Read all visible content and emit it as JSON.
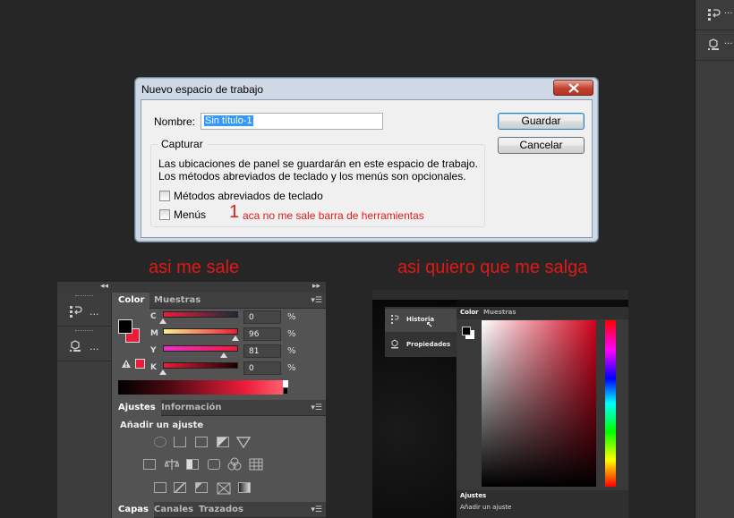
{
  "dialog": {
    "title": "Nuevo espacio de trabajo",
    "name_label": "Nombre:",
    "name_value": "Sin título-1",
    "save_label": "Guardar",
    "cancel_label": "Cancelar",
    "group_label": "Capturar",
    "description_line1": "Las ubicaciones de panel se guardarán en este espacio de trabajo.",
    "description_line2": "Los métodos abreviados de teclado y los menús son opcionales.",
    "checkbox_shortcuts": "Métodos abreviados de teclado",
    "checkbox_menus": "Menús",
    "annotation_number": "1",
    "annotation_text": "aca no me sale barra de herramientas"
  },
  "captions": {
    "left": "asi me sale",
    "right": "asi quiero que me salga"
  },
  "right_dock": {
    "items": [
      {
        "icon": "history-icon",
        "dots": "..."
      },
      {
        "icon": "properties-icon",
        "dots": "..."
      }
    ]
  },
  "left_screenshot": {
    "dock_items": [
      {
        "icon": "history-icon",
        "dots": "..."
      },
      {
        "icon": "properties-icon",
        "dots": "..."
      }
    ],
    "collapse_left": "◂◂",
    "collapse_right": "▸▸",
    "color_tabs": [
      "Color",
      "Muestras"
    ],
    "sliders": [
      {
        "label": "C",
        "value": "0",
        "unit": "%",
        "level": 0.0
      },
      {
        "label": "M",
        "value": "96",
        "unit": "%",
        "level": 0.96
      },
      {
        "label": "Y",
        "value": "81",
        "unit": "%",
        "level": 0.81
      },
      {
        "label": "K",
        "value": "0",
        "unit": "%",
        "level": 0.0
      }
    ],
    "adjust_tabs": [
      "Ajustes",
      "Información"
    ],
    "adjust_heading": "Añadir un ajuste",
    "bottom_tabs": [
      "Capas",
      "Canales",
      "Trazados"
    ],
    "colors": {
      "foreground": "#000000",
      "background": "#ed1c3a",
      "accent": "#e21a1a"
    }
  },
  "right_screenshot": {
    "dock_items": [
      "Historia",
      "Propiedades"
    ],
    "color_tabs": [
      "Color",
      "Muestras"
    ],
    "adjust_tab": "Ajustes",
    "adjust_heading": "Añadir un ajuste"
  }
}
